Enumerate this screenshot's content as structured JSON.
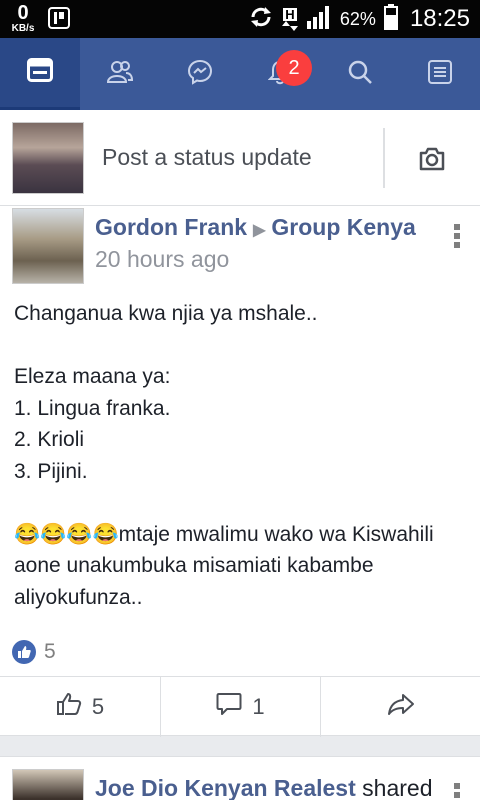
{
  "status_bar": {
    "speed_value": "0",
    "speed_unit": "KB/s",
    "battery": "62%",
    "time": "18:25",
    "network": "H"
  },
  "nav": {
    "tabs": [
      {
        "icon": "news-feed-icon"
      },
      {
        "icon": "friends-icon"
      },
      {
        "icon": "messenger-icon"
      },
      {
        "icon": "notifications-icon"
      },
      {
        "icon": "search-icon"
      },
      {
        "icon": "menu-icon"
      }
    ],
    "notification_count": "2"
  },
  "composer": {
    "placeholder": "Post a status update"
  },
  "post": {
    "author": "Gordon Frank",
    "group": "Group Kenya",
    "time": "20 hours ago",
    "body": "Changanua kwa njia ya mshale..\n\nEleza maana ya:\n1. Lingua franka.\n2. Krioli\n3. Pijini.\n\n😂😂😂😂mtaje mwalimu wako wa Kiswahili aone unakumbuka misamiati kabambe aliyokufunza..",
    "like_count": "5",
    "actions": {
      "likes": "5",
      "comments": "1"
    }
  },
  "next_post": {
    "author": "Joe Dio Kenyan Realest",
    "verb": "shared"
  },
  "colors": {
    "brand": "#3b5998",
    "badge": "#fa3e3e",
    "link": "#4a5f8f"
  }
}
